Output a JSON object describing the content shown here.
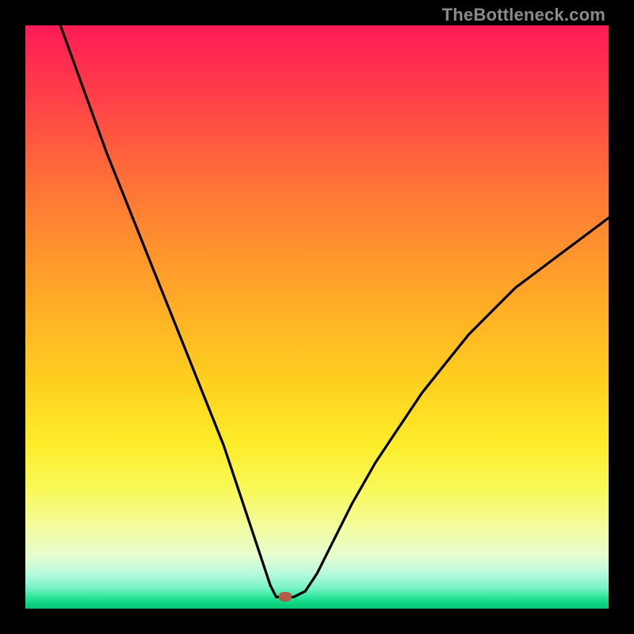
{
  "watermark": "TheBottleneck.com",
  "marker": {
    "left_pct": 44.5,
    "top_pct": 98.0,
    "color": "#b85a4a"
  },
  "chart_data": {
    "type": "line",
    "title": "",
    "xlabel": "",
    "ylabel": "",
    "xlim": [
      0,
      100
    ],
    "ylim": [
      0,
      100
    ],
    "series": [
      {
        "name": "bottleneck-curve",
        "x": [
          6,
          10,
          14,
          18,
          22,
          26,
          30,
          34,
          38,
          40,
          42,
          43,
          44,
          45,
          46,
          48,
          50,
          52,
          56,
          60,
          64,
          68,
          72,
          76,
          80,
          84,
          88,
          92,
          96,
          100
        ],
        "y": [
          100,
          89,
          78,
          68,
          58,
          48,
          38,
          28,
          16,
          10,
          4,
          2,
          2,
          2,
          2,
          3,
          6,
          10,
          18,
          25,
          31,
          37,
          42,
          47,
          51,
          55,
          58,
          61,
          64,
          67
        ]
      }
    ],
    "annotations": [
      {
        "name": "optimal-point",
        "x": 44.5,
        "y": 2
      }
    ]
  }
}
